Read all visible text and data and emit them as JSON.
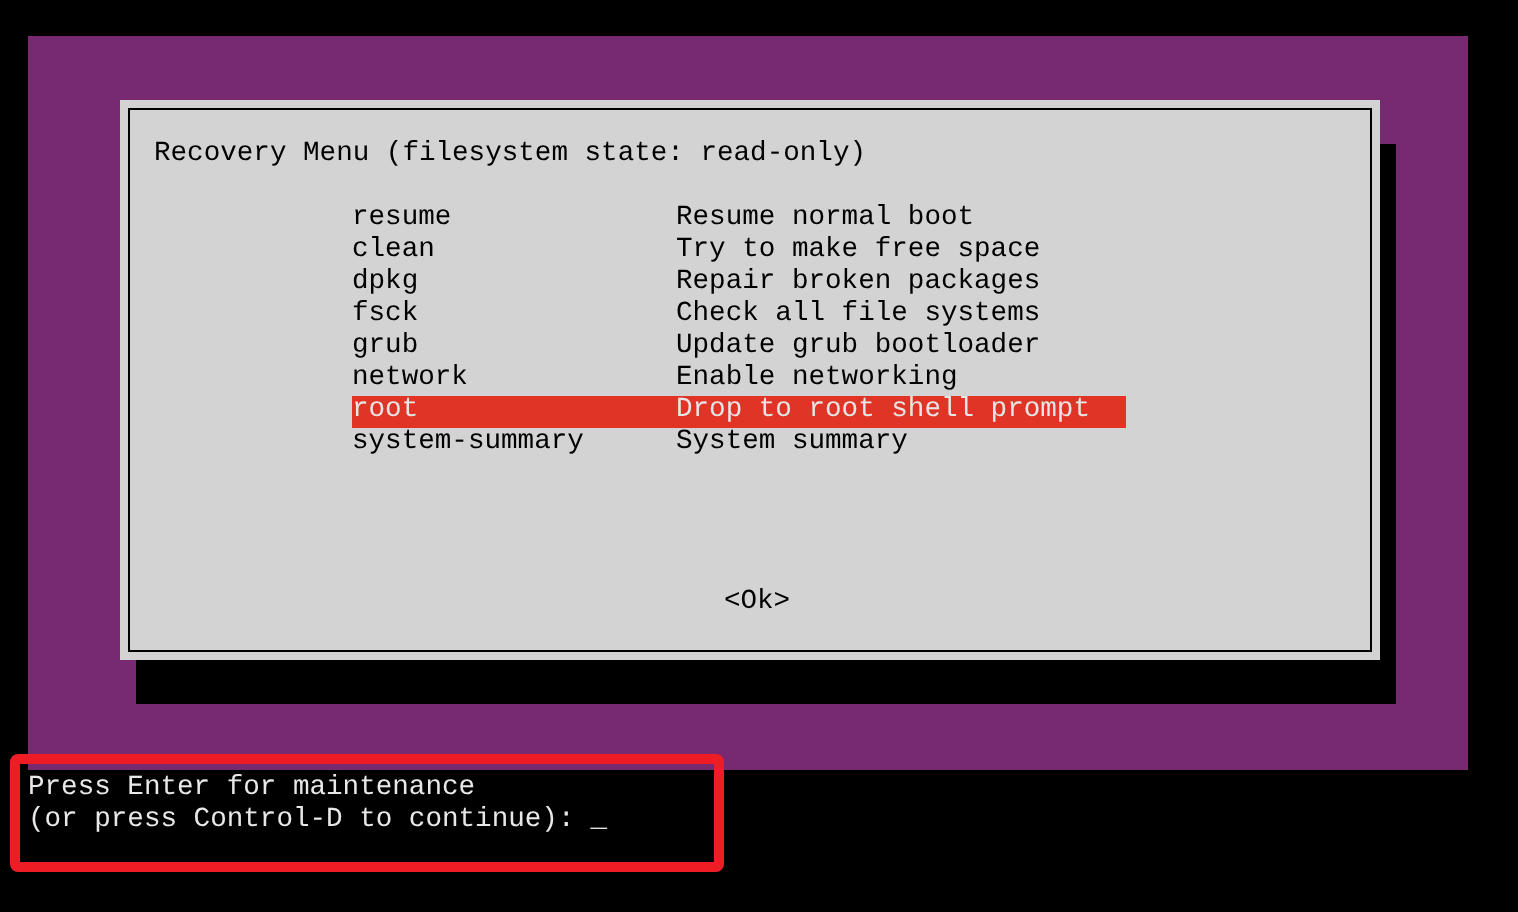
{
  "dialog": {
    "title": "Recovery Menu (filesystem state: read-only)",
    "items": [
      {
        "command": "resume",
        "description": "Resume normal boot",
        "selected": false
      },
      {
        "command": "clean",
        "description": "Try to make free space",
        "selected": false
      },
      {
        "command": "dpkg",
        "description": "Repair broken packages",
        "selected": false
      },
      {
        "command": "fsck",
        "description": "Check all file systems",
        "selected": false
      },
      {
        "command": "grub",
        "description": "Update grub bootloader",
        "selected": false
      },
      {
        "command": "network",
        "description": "Enable networking",
        "selected": false
      },
      {
        "command": "root",
        "description": "Drop to root shell prompt",
        "selected": true
      },
      {
        "command": "system-summary",
        "description": "System summary",
        "selected": false
      }
    ],
    "button": "<Ok>"
  },
  "terminal": {
    "lines": [
      "Press Enter for maintenance",
      "(or press Control-D to continue):"
    ],
    "cursor": "_"
  },
  "highlight_frame": true
}
